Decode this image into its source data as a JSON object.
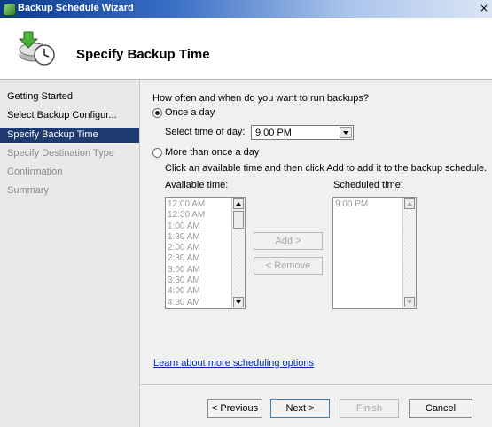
{
  "window": {
    "title": "Backup Schedule Wizard",
    "close_glyph": "×"
  },
  "header": {
    "title": "Specify Backup Time",
    "icon": "backup-clock-icon"
  },
  "sidebar": {
    "items": [
      {
        "label": "Getting Started",
        "state": "normal"
      },
      {
        "label": "Select Backup Configur...",
        "state": "normal"
      },
      {
        "label": "Specify Backup Time",
        "state": "active"
      },
      {
        "label": "Specify Destination Type",
        "state": "disabled"
      },
      {
        "label": "Confirmation",
        "state": "disabled"
      },
      {
        "label": "Summary",
        "state": "disabled"
      }
    ]
  },
  "main": {
    "question": "How often and when do you want to run backups?",
    "option_once": {
      "label": "Once a day",
      "selected": true
    },
    "select_time_label": "Select time of day:",
    "select_time_value": "9:00 PM",
    "option_multiple": {
      "label": "More than once a day",
      "selected": false
    },
    "instruction": "Click an available time and then click Add to add it to the backup schedule.",
    "available_label": "Available time:",
    "scheduled_label": "Scheduled time:",
    "available_times": [
      "12:00 AM",
      "12:30 AM",
      "1:00 AM",
      "1:30 AM",
      "2:00 AM",
      "2:30 AM",
      "3:00 AM",
      "3:30 AM",
      "4:00 AM",
      "4:30 AM"
    ],
    "scheduled_times": [
      "9:00 PM"
    ],
    "add_button": "Add >",
    "remove_button": "< Remove",
    "learn_link": "Learn about more scheduling options"
  },
  "footer": {
    "previous": "< Previous",
    "next": "Next >",
    "finish": "Finish",
    "cancel": "Cancel"
  }
}
